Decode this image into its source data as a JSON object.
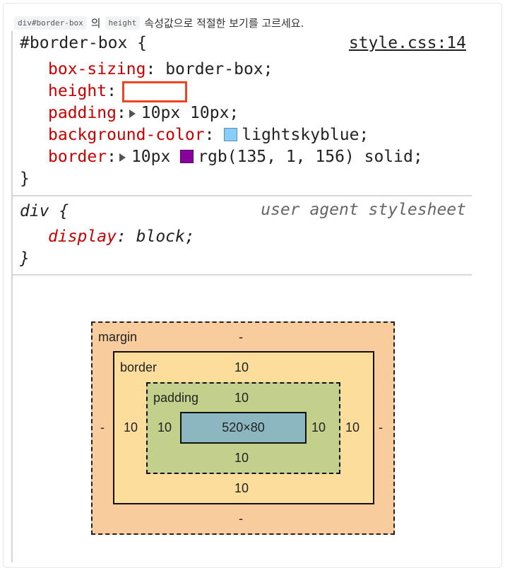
{
  "question": {
    "code_selector": "div#border-box",
    "particle": "의",
    "code_property": "height",
    "text": "속성값으로 적절한 보기를 고르세요."
  },
  "rule1": {
    "selector": "#border-box {",
    "source_link": "style.css:14",
    "declarations": [
      {
        "prop": "box-sizing",
        "value": "border-box;"
      },
      {
        "prop": "height",
        "value": ""
      },
      {
        "prop": "padding",
        "value": "10px 10px;"
      },
      {
        "prop": "background-color",
        "value": "lightskyblue;"
      },
      {
        "prop": "border",
        "value_before": "10px",
        "value_after": "rgb(135, 1, 156) solid;"
      }
    ],
    "close": "}",
    "colors": {
      "lightskyblue": "#87cefa",
      "border": "#87019c"
    }
  },
  "rule2": {
    "selector": "div {",
    "origin": "user agent stylesheet",
    "declaration": {
      "prop": "display",
      "value": "block;"
    },
    "close": "}"
  },
  "box_model": {
    "margin": {
      "label": "margin",
      "top": "-",
      "right": "-",
      "bottom": "-",
      "left": "-"
    },
    "border": {
      "label": "border",
      "top": "10",
      "right": "10",
      "bottom": "10",
      "left": "10"
    },
    "padding": {
      "label": "padding",
      "top": "10",
      "right": "10",
      "bottom": "10",
      "left": "10"
    },
    "content": "520×80"
  }
}
